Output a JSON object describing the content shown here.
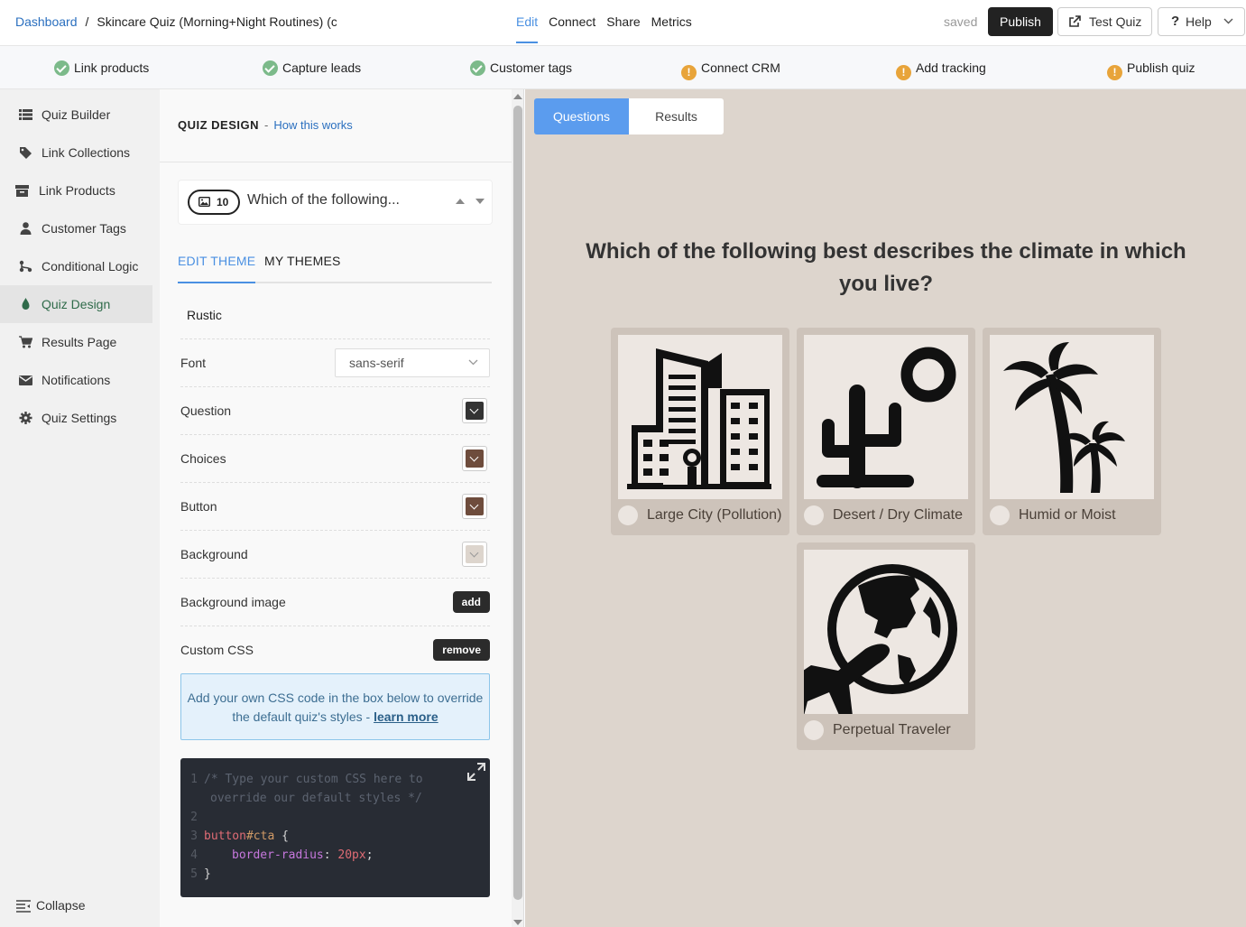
{
  "breadcrumb": {
    "dashboard": "Dashboard",
    "separator": "/",
    "title": "Skincare Quiz (Morning+Night Routines) (c"
  },
  "topnav": {
    "edit": "Edit",
    "connect": "Connect",
    "share": "Share",
    "metrics": "Metrics"
  },
  "status": {
    "saved": "saved"
  },
  "actions": {
    "publish": "Publish",
    "test_quiz": "Test Quiz",
    "help": "Help",
    "help_glyph": "?"
  },
  "checklist": [
    {
      "label": "Link products",
      "state": "done"
    },
    {
      "label": "Capture leads",
      "state": "done"
    },
    {
      "label": "Customer tags",
      "state": "done"
    },
    {
      "label": "Connect CRM",
      "state": "warning"
    },
    {
      "label": "Add tracking",
      "state": "warning"
    },
    {
      "label": "Publish quiz",
      "state": "warning"
    }
  ],
  "warning_glyph": "!",
  "sidebar": {
    "items": [
      {
        "label": "Quiz Builder",
        "icon": "list-icon"
      },
      {
        "label": "Link Collections",
        "icon": "tag-icon"
      },
      {
        "label": "Link Products",
        "icon": "box-icon"
      },
      {
        "label": "Customer Tags",
        "icon": "user-icon"
      },
      {
        "label": "Conditional Logic",
        "icon": "branch-icon"
      },
      {
        "label": "Quiz Design",
        "icon": "droplet-icon",
        "active": true
      },
      {
        "label": "Results Page",
        "icon": "cart-icon"
      },
      {
        "label": "Notifications",
        "icon": "envelope-icon"
      },
      {
        "label": "Quiz Settings",
        "icon": "gear-icon"
      }
    ],
    "collapse": "Collapse"
  },
  "design": {
    "heading": "QUIZ DESIGN",
    "dash": "-",
    "how_link": "How this works",
    "question_select": {
      "number": "10",
      "text": "Which of the following..."
    },
    "tabs": {
      "edit_theme": "EDIT THEME",
      "my_themes": "MY THEMES"
    },
    "theme_name": "Rustic",
    "font_label": "Font",
    "font_value": "sans-serif",
    "question_label": "Question",
    "choices_label": "Choices",
    "button_label": "Button",
    "background_label": "Background",
    "background_image_label": "Background image",
    "add_label": "add",
    "custom_css_label": "Custom CSS",
    "remove_label": "remove",
    "css_info_text": "Add your own CSS code in the box below to override the default quiz's styles -",
    "learn_more": "learn more",
    "code": {
      "l1_num": "1",
      "l1": "/* Type your custom CSS here to",
      "l1b": "override our default styles */",
      "l2_num": "2",
      "l3_num": "3",
      "l3_sel": "button",
      "l3_id": "#cta",
      "l3_brace": " {",
      "l4_num": "4",
      "l4_prop": "border-radius",
      "l4_colon": ": ",
      "l4_val": "20px",
      "l4_semi": ";",
      "l5_num": "5",
      "l5": "}"
    }
  },
  "colors": {
    "question": "#333333",
    "choices": "#6e4c3c",
    "button": "#6e4c3c",
    "background": "#ddd5cd",
    "accent": "#4a90e2"
  },
  "preview": {
    "tabs": {
      "questions": "Questions",
      "results": "Results"
    },
    "question": "Which of the following best describes the climate in which you live?",
    "choices": [
      {
        "label": "Large City (Pollution)",
        "icon": "city-icon"
      },
      {
        "label": "Desert / Dry Climate",
        "icon": "cactus-icon"
      },
      {
        "label": "Humid or Moist",
        "icon": "palm-tree-icon"
      },
      {
        "label": "Perpetual Traveler",
        "icon": "globe-plane-icon"
      }
    ]
  }
}
